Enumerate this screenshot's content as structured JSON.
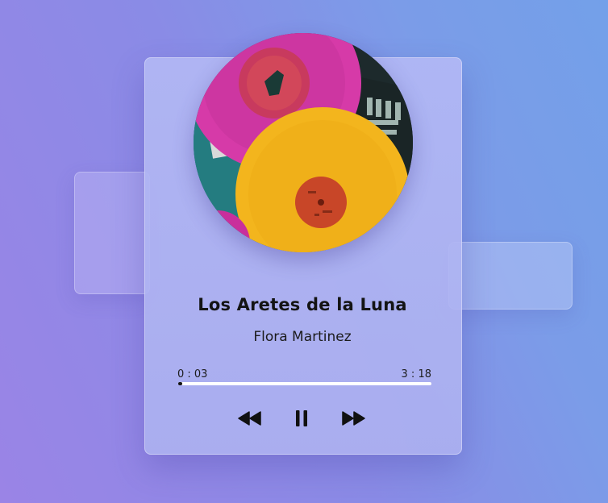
{
  "track": {
    "title": "Los Aretes de la Luna",
    "artist": "Flora Martinez"
  },
  "playback": {
    "current_time": "0 : 03",
    "total_time": "3 : 18",
    "progress_fraction": 0.016
  },
  "controls": {
    "rewind_icon": "rewind-icon",
    "pause_icon": "pause-icon",
    "forward_icon": "fast-forward-icon"
  },
  "colors": {
    "accent": "#141414",
    "track": "#ffffff"
  }
}
